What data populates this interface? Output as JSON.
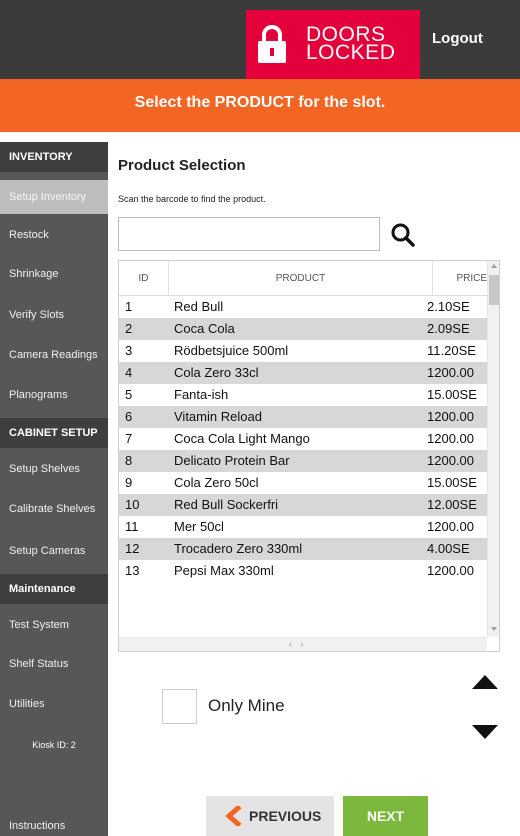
{
  "header": {
    "doors_line1": "DOORS",
    "doors_line2": "LOCKED",
    "logout_label": "Logout"
  },
  "banner": {
    "text": "Select the PRODUCT for the slot."
  },
  "sidebar": {
    "items": [
      {
        "label": "INVENTORY",
        "kind": "header"
      },
      {
        "label": "Setup Inventory",
        "kind": "active"
      },
      {
        "label": "Restock",
        "kind": "link"
      },
      {
        "label": "Shrinkage",
        "kind": "link"
      },
      {
        "label": "Verify Slots",
        "kind": "link"
      },
      {
        "label": "Camera Readings",
        "kind": "link"
      },
      {
        "label": "Planograms",
        "kind": "link"
      },
      {
        "label": "CABINET SETUP",
        "kind": "header"
      },
      {
        "label": "Setup Shelves",
        "kind": "link"
      },
      {
        "label": "Calibrate Shelves",
        "kind": "link"
      },
      {
        "label": "Setup Cameras",
        "kind": "link"
      },
      {
        "label": "Maintenance",
        "kind": "header"
      },
      {
        "label": "Test System",
        "kind": "link"
      },
      {
        "label": "Shelf Status",
        "kind": "link"
      },
      {
        "label": "Utilities",
        "kind": "link"
      }
    ],
    "kiosk_id": "Kiosk ID: 2",
    "instructions": "Instructions"
  },
  "main": {
    "title": "Product Selection",
    "hint": "Scan the barcode to find the product.",
    "search_value": "",
    "only_mine_label": "Only Mine",
    "only_mine_checked": false
  },
  "table": {
    "columns": [
      "ID",
      "PRODUCT",
      "PRICE"
    ],
    "rows": [
      {
        "id": "1",
        "product": "Red Bull",
        "price": "2.10SE"
      },
      {
        "id": "2",
        "product": "Coca Cola",
        "price": "2.09SE"
      },
      {
        "id": "3",
        "product": "Rödbetsjuice 500ml",
        "price": "11.20SE"
      },
      {
        "id": "4",
        "product": "Cola Zero 33cl",
        "price": "1200.00"
      },
      {
        "id": "5",
        "product": "Fanta-ish",
        "price": "15.00SE"
      },
      {
        "id": "6",
        "product": "Vitamin Reload",
        "price": "1200.00"
      },
      {
        "id": "7",
        "product": "Coca Cola Light Mango",
        "price": "1200.00"
      },
      {
        "id": "8",
        "product": "Delicato Protein Bar",
        "price": "1200.00"
      },
      {
        "id": "9",
        "product": "Cola Zero 50cl",
        "price": "15.00SE"
      },
      {
        "id": "10",
        "product": "Red Bull Sockerfri",
        "price": "12.00SE"
      },
      {
        "id": "11",
        "product": "Mer 50cl",
        "price": "1200.00"
      },
      {
        "id": "12",
        "product": "Trocadero Zero 330ml",
        "price": "4.00SE"
      },
      {
        "id": "13",
        "product": "Pepsi Max 330ml",
        "price": "1200.00"
      }
    ]
  },
  "footer": {
    "previous_label": "PREVIOUS",
    "next_label": "NEXT"
  },
  "colors": {
    "header_bg": "#3a3a3a",
    "doors_red": "#e4003a",
    "banner_orange": "#f26522",
    "sidebar_bg": "#575757",
    "next_green": "#7bb83b",
    "prev_chevron": "#f26522"
  },
  "icons": {
    "lock": "padlock-icon",
    "search": "magnifier-icon",
    "scroll_up": "triangle-up-icon",
    "scroll_down": "triangle-down-icon",
    "previous": "chevron-left-icon"
  }
}
